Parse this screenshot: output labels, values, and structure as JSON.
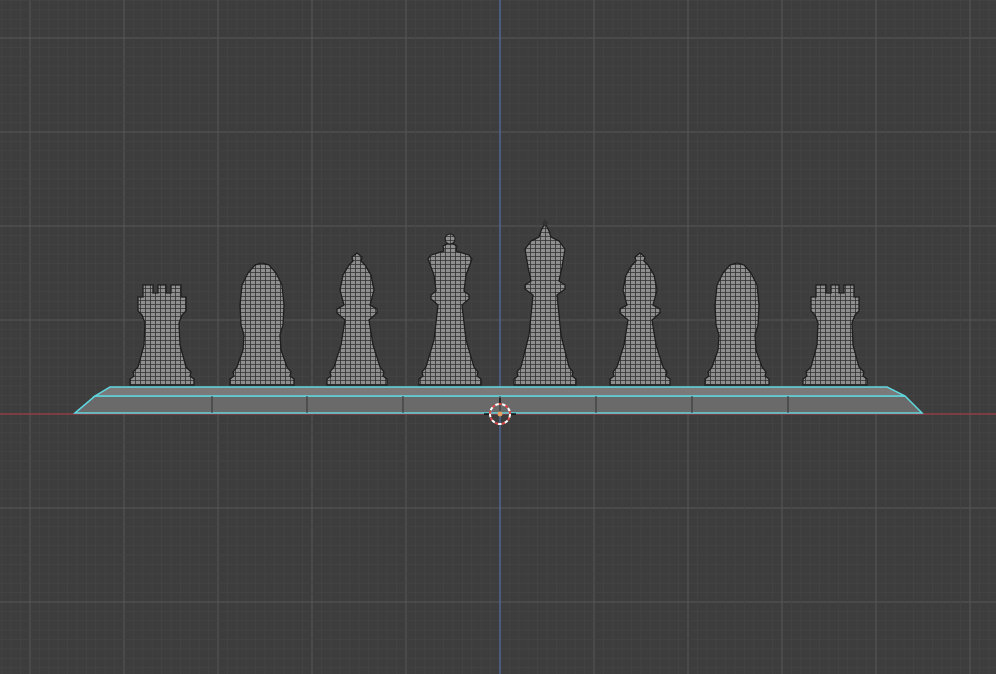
{
  "viewport": {
    "colors": {
      "background": "#3d3d3d",
      "grid_minor": "#444444",
      "grid_major": "#535353",
      "axis_x": "#9b3b45",
      "axis_y": "#4f6fa6",
      "selection_outline": "#5fd8e0",
      "mesh_fill": "#8c8c8c",
      "mesh_wire": "#2e2e2e",
      "board_fill": "#6a6a6a"
    },
    "pieces": [
      "rook",
      "knight",
      "bishop",
      "queen",
      "king",
      "bishop",
      "knight",
      "rook"
    ]
  }
}
